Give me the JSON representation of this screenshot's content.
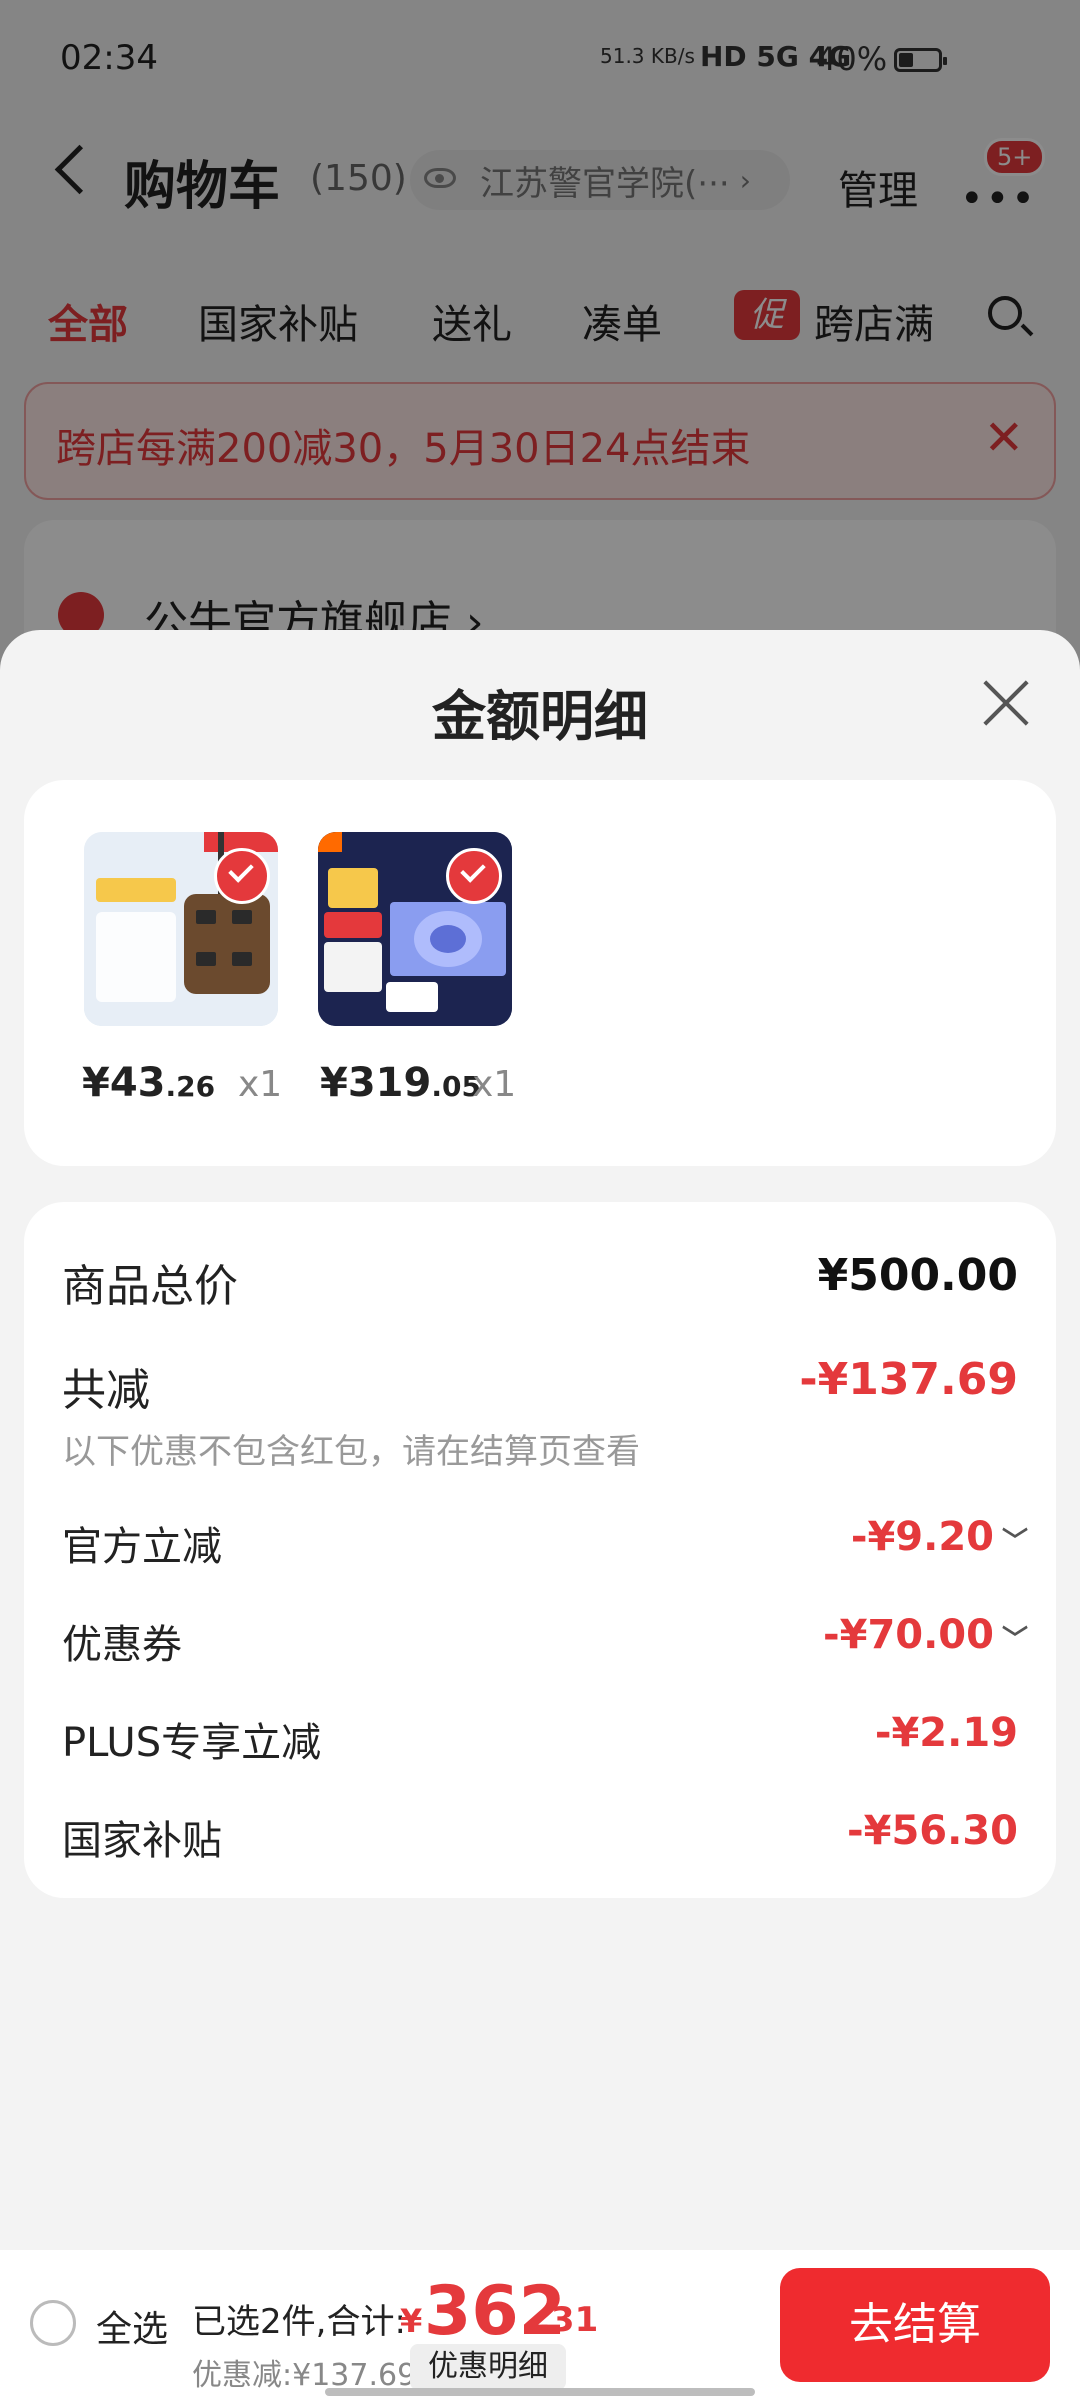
{
  "status_bar": {
    "time": "02:34",
    "net_speed": "51.3 KB/s",
    "signals": "HD 5G 4G",
    "battery": "40%"
  },
  "header": {
    "title": "购物车",
    "count": "(150)",
    "location": "江苏警官学院(···",
    "manage": "管理",
    "badge": "5+"
  },
  "tabs": [
    "全部",
    "国家补贴",
    "送礼",
    "凑单",
    "跨店满"
  ],
  "promo_tag": "促",
  "banner": {
    "text": "跨店每满200减30，5月30日24点结束"
  },
  "shop": {
    "name": "公牛官方旗舰店 ›"
  },
  "sheet": {
    "title": "金额明细",
    "products": [
      {
        "currency": "¥",
        "price_int": "43",
        "price_dec": ".26",
        "qty": "x1"
      },
      {
        "currency": "¥",
        "price_int": "319",
        "price_dec": ".05",
        "qty": "x1"
      }
    ],
    "details": {
      "total_label": "商品总价",
      "total_value": "¥500.00",
      "discount_label": "共减",
      "discount_value": "-¥137.69",
      "note": "以下优惠不包含红包，请在结算页查看",
      "items": [
        {
          "label": "官方立减",
          "value": "-¥9.20",
          "expandable": true
        },
        {
          "label": "优惠券",
          "value": "-¥70.00",
          "expandable": true
        },
        {
          "label": "PLUS专享立减",
          "value": "-¥2.19",
          "expandable": false
        },
        {
          "label": "国家补贴",
          "value": "-¥56.30",
          "expandable": false
        }
      ]
    }
  },
  "bottom_bar": {
    "select_all": "全选",
    "selected_text": "已选2件,合计:",
    "currency": "¥",
    "total_int": "362",
    "total_dec": ".31",
    "discount_text": "优惠减:¥137.69",
    "detail_button": "优惠明细",
    "checkout": "去结算"
  },
  "colors": {
    "accent": "#e4393c",
    "checkout": "#ef2b2f"
  }
}
